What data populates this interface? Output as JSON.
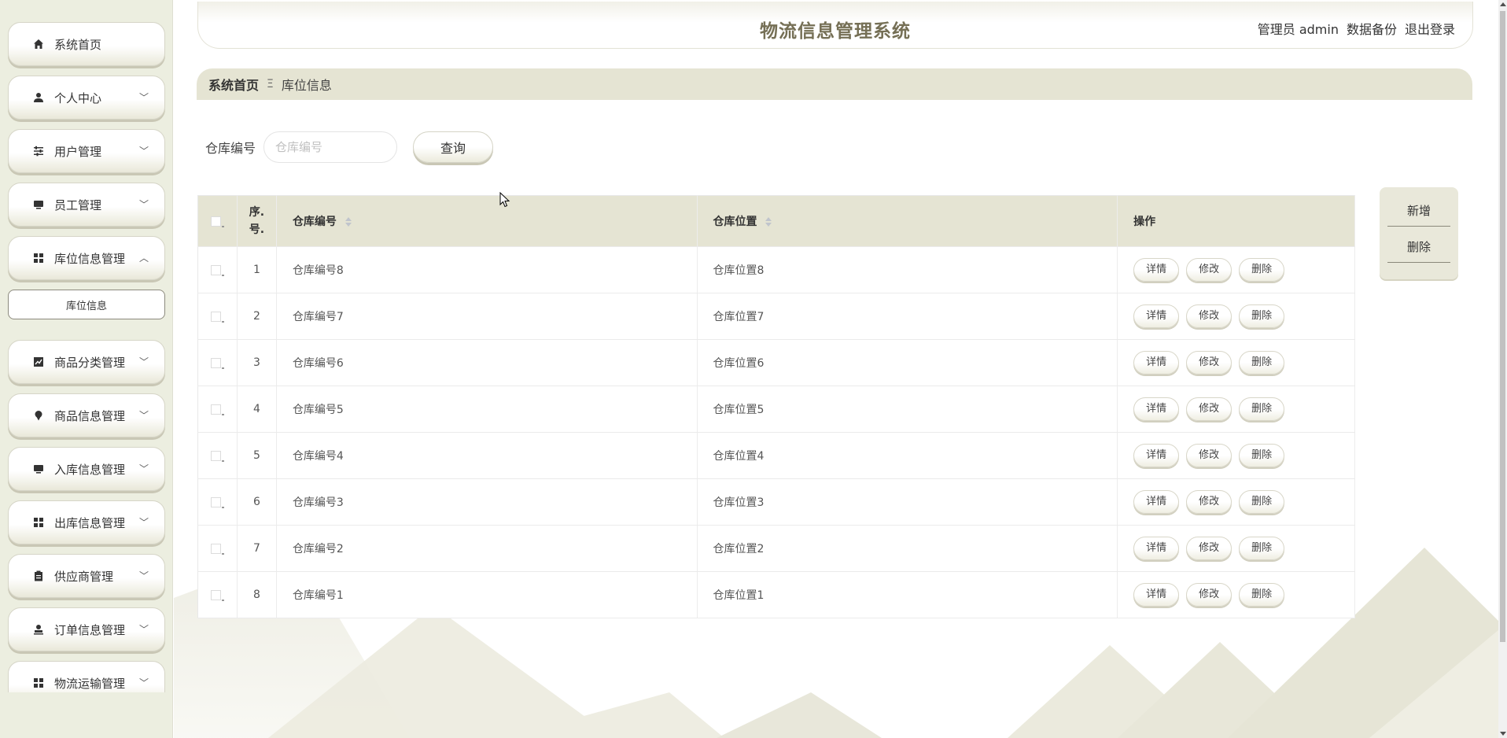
{
  "app": {
    "title": "物流信息管理系统",
    "user_label": "管理员 admin",
    "backup_label": "数据备份",
    "logout_label": "退出登录"
  },
  "sidebar": {
    "items": [
      {
        "label": "系统首页",
        "icon": "home-icon",
        "chevron": ""
      },
      {
        "label": "个人中心",
        "icon": "user-icon",
        "chevron": "﹀"
      },
      {
        "label": "用户管理",
        "icon": "sliders-icon",
        "chevron": "﹀"
      },
      {
        "label": "员工管理",
        "icon": "monitor-icon",
        "chevron": "﹀"
      },
      {
        "label": "库位信息管理",
        "icon": "grid-icon",
        "chevron": "︿"
      },
      {
        "label": "商品分类管理",
        "icon": "chart-icon",
        "chevron": "﹀"
      },
      {
        "label": "商品信息管理",
        "icon": "pin-icon",
        "chevron": "﹀"
      },
      {
        "label": "入库信息管理",
        "icon": "monitor-icon",
        "chevron": "﹀"
      },
      {
        "label": "出库信息管理",
        "icon": "grid-icon",
        "chevron": "﹀"
      },
      {
        "label": "供应商管理",
        "icon": "clipboard-icon",
        "chevron": "﹀"
      },
      {
        "label": "订单信息管理",
        "icon": "person-icon",
        "chevron": "﹀"
      },
      {
        "label": "物流运输管理",
        "icon": "grid-icon",
        "chevron": "﹀"
      }
    ],
    "submenu_label": "库位信息"
  },
  "breadcrumb": {
    "home": "系统首页",
    "separator": "Ξ",
    "current": "库位信息"
  },
  "search": {
    "label": "仓库编号",
    "placeholder": "仓库编号",
    "value": "",
    "button": "查询"
  },
  "table": {
    "columns": {
      "index": "序.号.",
      "code": "仓库编号",
      "location": "仓库位置",
      "ops": "操作"
    },
    "rows": [
      {
        "idx": "1",
        "code": "仓库编号8",
        "location": "仓库位置8"
      },
      {
        "idx": "2",
        "code": "仓库编号7",
        "location": "仓库位置7"
      },
      {
        "idx": "3",
        "code": "仓库编号6",
        "location": "仓库位置6"
      },
      {
        "idx": "4",
        "code": "仓库编号5",
        "location": "仓库位置5"
      },
      {
        "idx": "5",
        "code": "仓库编号4",
        "location": "仓库位置4"
      },
      {
        "idx": "6",
        "code": "仓库编号3",
        "location": "仓库位置3"
      },
      {
        "idx": "7",
        "code": "仓库编号2",
        "location": "仓库位置2"
      },
      {
        "idx": "8",
        "code": "仓库编号1",
        "location": "仓库位置1"
      }
    ],
    "op_labels": {
      "detail": "详情",
      "edit": "修改",
      "delete": "删除"
    }
  },
  "actions": {
    "add": "新增",
    "delete": "删除"
  },
  "colors": {
    "accent": "#756f55",
    "panel": "#e5e4d3",
    "sidebar_bg": "#eceee0"
  }
}
